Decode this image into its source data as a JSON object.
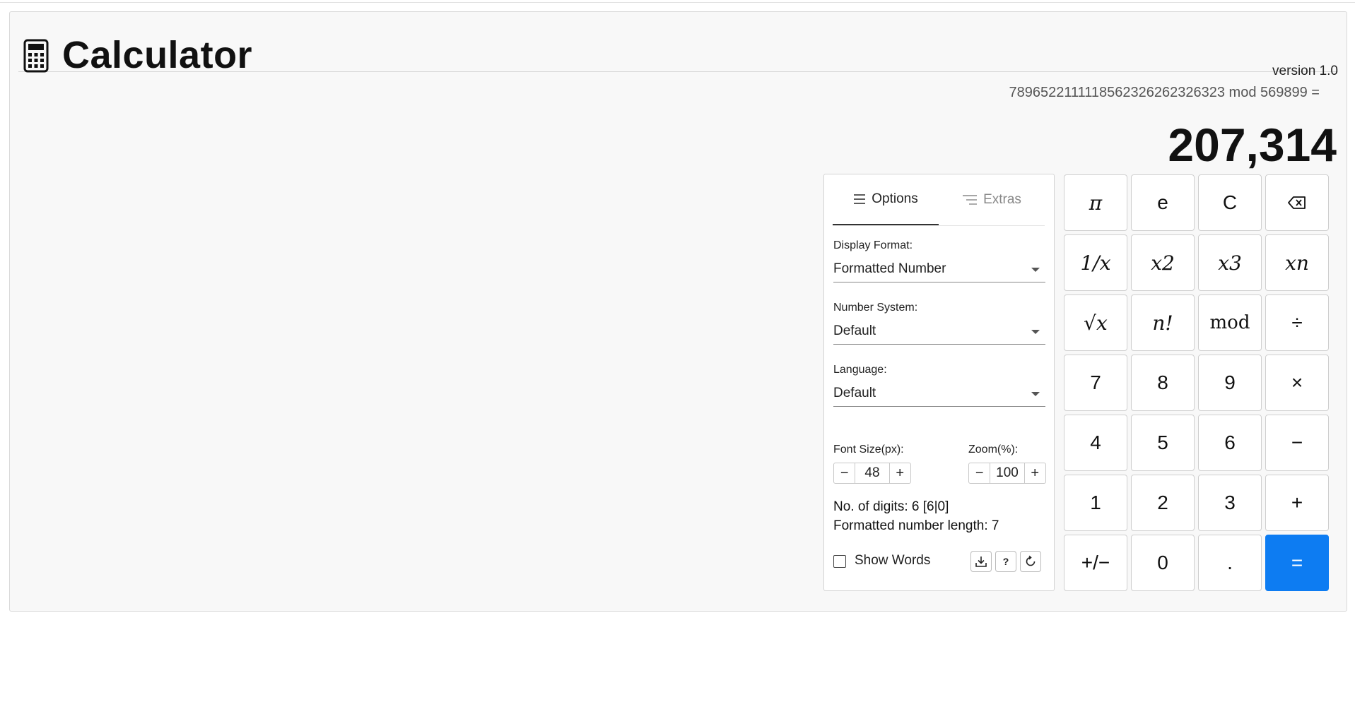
{
  "app": {
    "title": "Calculator",
    "version": "version 1.0",
    "icon": "calculator-icon"
  },
  "display": {
    "expression": "7896522111118562326262326323 mod 569899 =",
    "result": "207,314"
  },
  "options_panel": {
    "tabs": [
      {
        "label": "Options",
        "icon": "list-icon",
        "active": true
      },
      {
        "label": "Extras",
        "icon": "list-indent-icon",
        "active": false
      }
    ],
    "display_format": {
      "label": "Display Format:",
      "value": "Formatted Number"
    },
    "number_system": {
      "label": "Number System:",
      "value": "Default"
    },
    "language": {
      "label": "Language:",
      "value": "Default"
    },
    "font_size": {
      "label": "Font Size(px):",
      "value": "48",
      "minus": "−",
      "plus": "+"
    },
    "zoom": {
      "label": "Zoom(%):",
      "value": "100",
      "minus": "−",
      "plus": "+"
    },
    "digits_info": "No. of digits: 6 [6|0]",
    "length_info": "Formatted number length: 7",
    "show_words": {
      "label": "Show Words",
      "checked": false
    },
    "actions": [
      {
        "name": "download-icon"
      },
      {
        "label": "?",
        "name": "help-icon"
      },
      {
        "name": "refresh-icon"
      }
    ]
  },
  "keypad": {
    "rows": [
      [
        "π",
        "e",
        "C",
        "⌫"
      ],
      [
        "1/x",
        "x2",
        "x3",
        "xn"
      ],
      [
        "√x",
        "n!",
        "mod",
        "÷"
      ],
      [
        "7",
        "8",
        "9",
        "×"
      ],
      [
        "4",
        "5",
        "6",
        "−"
      ],
      [
        "1",
        "2",
        "3",
        "+"
      ],
      [
        "+/−",
        "0",
        ".",
        "="
      ]
    ],
    "colors": {
      "equals_bg": "#0d7cf2"
    }
  }
}
